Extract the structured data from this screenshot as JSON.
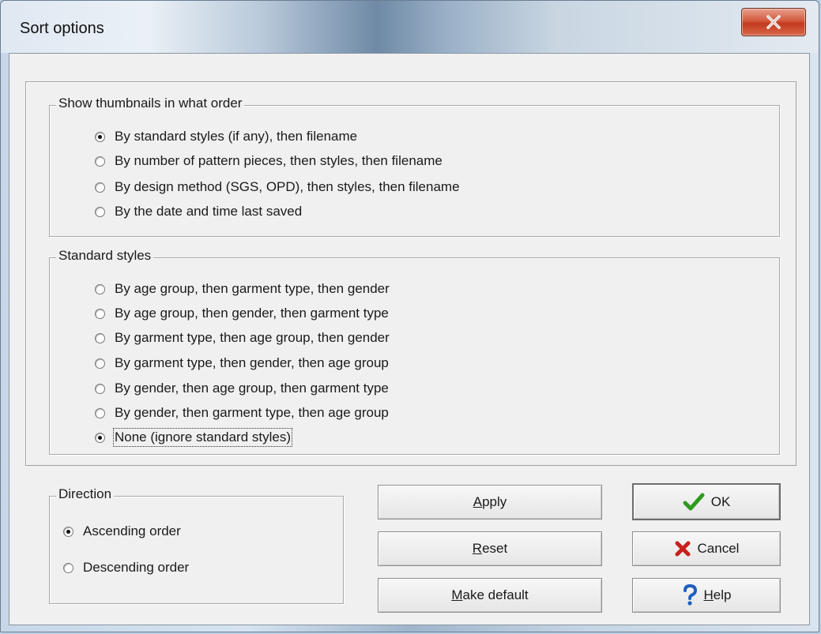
{
  "window": {
    "title": "Sort options",
    "close_symbol": "x"
  },
  "thumbnails_group": {
    "legend": "Show thumbnails in what order",
    "options": [
      {
        "label": "By standard styles (if any), then filename",
        "checked": true
      },
      {
        "label": "By number of pattern pieces, then styles, then filename",
        "checked": false
      },
      {
        "label": "By design method (SGS, OPD), then styles, then filename",
        "checked": false
      },
      {
        "label": "By the date and time last saved",
        "checked": false
      }
    ]
  },
  "styles_group": {
    "legend": "Standard styles",
    "options": [
      {
        "label": "By age group, then garment type, then gender",
        "checked": false
      },
      {
        "label": "By age group, then gender, then garment type",
        "checked": false
      },
      {
        "label": "By garment type, then age group, then gender",
        "checked": false
      },
      {
        "label": "By garment type, then gender, then age group",
        "checked": false
      },
      {
        "label": "By gender, then age group, then garment type",
        "checked": false
      },
      {
        "label": "By gender, then garment type, then age group",
        "checked": false
      },
      {
        "label": "None (ignore standard styles)",
        "checked": true
      }
    ]
  },
  "direction_group": {
    "legend": "Direction",
    "options": [
      {
        "label": "Ascending order",
        "checked": true
      },
      {
        "label": "Descending order",
        "checked": false
      }
    ]
  },
  "buttons": {
    "apply": {
      "mnemonic": "A",
      "rest": "pply"
    },
    "reset": {
      "mnemonic": "R",
      "rest": "eset"
    },
    "make_default": {
      "mnemonic": "M",
      "rest": "ake default"
    },
    "ok": {
      "label": "OK",
      "icon": "checkmark-icon",
      "icon_color": "#2e9a1e"
    },
    "cancel": {
      "label": "Cancel",
      "icon": "red-x-icon",
      "icon_color": "#c8201a"
    },
    "help": {
      "mnemonic": "H",
      "rest": "elp",
      "icon": "question-icon",
      "icon_color": "#1f5fbf"
    }
  },
  "colors": {
    "dialog_background": "#f0f0f0",
    "close_button": "#c9452a"
  }
}
